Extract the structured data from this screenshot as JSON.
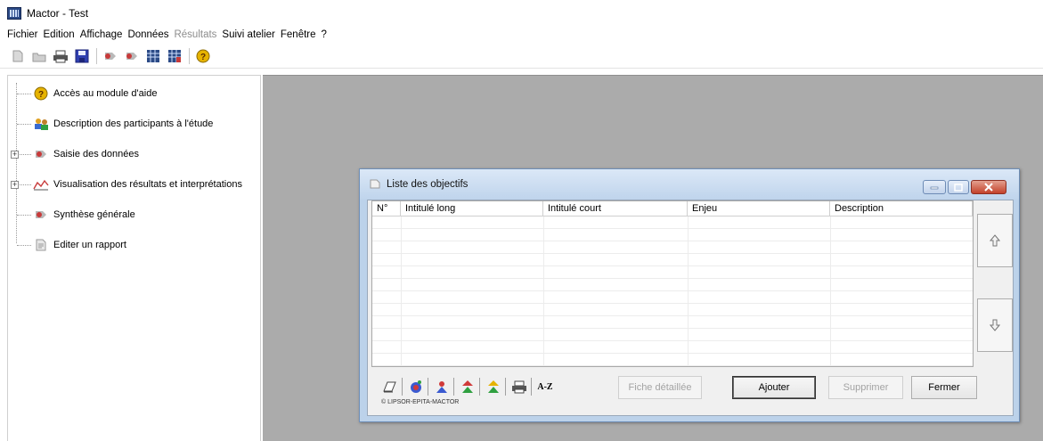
{
  "window": {
    "title": "Mactor - Test"
  },
  "menu": [
    "Fichier",
    "Edition",
    "Affichage",
    "Données",
    "Résultats",
    "Suivi atelier",
    "Fenêtre",
    "?"
  ],
  "tree": {
    "items": [
      {
        "label": "Accès au module d'aide",
        "icon": "help-icon"
      },
      {
        "label": "Description des participants à l'étude",
        "icon": "participants-icon"
      },
      {
        "label": "Saisie des données",
        "icon": "data-entry-icon",
        "expandable": true
      },
      {
        "label": "Visualisation des résultats et interprétations",
        "icon": "chart-icon",
        "expandable": true
      },
      {
        "label": "Synthèse générale",
        "icon": "synthesis-icon"
      },
      {
        "label": "Editer un rapport",
        "icon": "report-icon"
      }
    ]
  },
  "dialog": {
    "title": "Liste des objectifs",
    "columns": [
      "N°",
      "Intitulé long",
      "Intitulé court",
      "Enjeu",
      "Description"
    ],
    "buttons": {
      "detail": "Fiche détaillée",
      "add": "Ajouter",
      "delete": "Supprimer",
      "close": "Fermer"
    },
    "sort_label": "A-Z",
    "copyright": "© LIPSOR-EPITA-MACTOR"
  },
  "colors": {
    "workspace": "#ababab",
    "dialog_frame": "#bcd2ea",
    "close_button": "#c3412a"
  }
}
